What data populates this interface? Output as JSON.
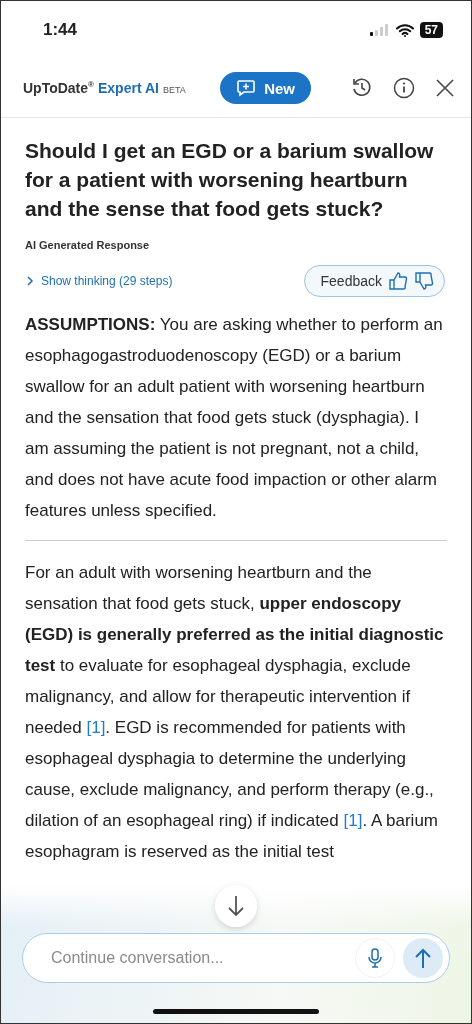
{
  "status_bar": {
    "time": "1:44",
    "battery": "57"
  },
  "header": {
    "brand": "UpToDate",
    "brand_mark": "®",
    "product": "Expert AI",
    "badge": "BETA",
    "new_button": "New"
  },
  "question": "Should I get an EGD or a barium swallow for a patient with worsening heartburn and the sense that food gets stuck?",
  "response_label": "AI Generated Response",
  "show_thinking": {
    "label": "Show thinking (29 steps)",
    "expanded": false
  },
  "feedback": {
    "label": "Feedback"
  },
  "assumptions": "**ASSUMPTIONS:** You are asking whether to perform an esophagogastroduodenoscopy (EGD) or a barium swallow for an adult patient with worsening heartburn and the sensation that food gets stuck (dysphagia). I am assuming the patient is not pregnant, not a child, and does not have acute food impaction or other alarm features unless specified.",
  "answer": [
    {
      "kind": "text",
      "text": "For an adult with worsening heartburn and the sensation that food gets stuck, "
    },
    {
      "kind": "bold",
      "text": "upper endoscopy (EGD) is generally preferred as the initial diagnostic test"
    },
    {
      "kind": "text",
      "text": " to evaluate for esophageal dysphagia, exclude malignancy, and allow for therapeutic intervention if needed "
    },
    {
      "kind": "cite",
      "text": "[1]"
    },
    {
      "kind": "text",
      "text": ". EGD is recommended for patients with esophageal dysphagia to determine the underlying cause, exclude malignancy, and perform therapy (e.g., dilation of an esophageal ring) if indicated "
    },
    {
      "kind": "cite",
      "text": "[1]"
    },
    {
      "kind": "text",
      "text": ". A barium esophagram is reserved as the initial test"
    }
  ],
  "composer": {
    "placeholder": "Continue conversation..."
  }
}
